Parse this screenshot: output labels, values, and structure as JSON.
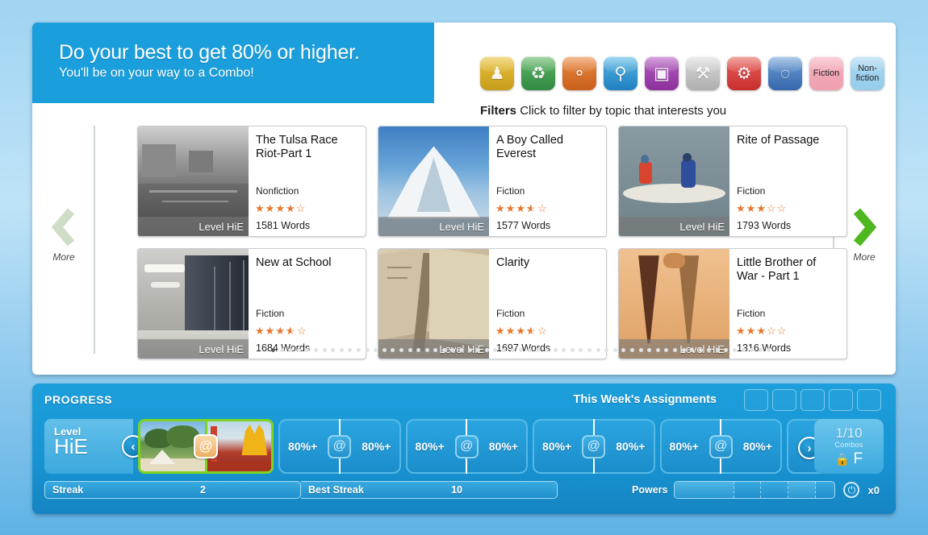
{
  "banner": {
    "line1": "Do your best to get 80% or higher.",
    "line2": "You'll be on your way to a Combo!"
  },
  "filters": {
    "caption_bold": "Filters",
    "caption_rest": "Click to filter by topic that interests you",
    "items": [
      {
        "name": "people-icon",
        "glyph": "♟",
        "color": "#e8c13a",
        "color2": "#c79c1c",
        "label": ""
      },
      {
        "name": "globe-recycle-icon",
        "glyph": "♻",
        "color": "#5fb463",
        "color2": "#2e8b42",
        "label": ""
      },
      {
        "name": "animal-icon",
        "glyph": "⚬",
        "color": "#e8853c",
        "color2": "#c9601c",
        "label": ""
      },
      {
        "name": "magnifier-science-icon",
        "glyph": "⚲",
        "color": "#57b6e4",
        "color2": "#1f7fc0",
        "label": ""
      },
      {
        "name": "camera-arts-icon",
        "glyph": "▣",
        "color": "#b35ec0",
        "color2": "#8d2f9c",
        "label": ""
      },
      {
        "name": "tools-icon",
        "glyph": "⚒",
        "color": "#dcdcdc",
        "color2": "#aeaeae",
        "label": ""
      },
      {
        "name": "gear-tech-icon",
        "glyph": "⚙",
        "color": "#e8605a",
        "color2": "#c72e2e",
        "label": ""
      },
      {
        "name": "basketball-sports-icon",
        "glyph": "◌",
        "color": "#6e9fd6",
        "color2": "#3567ab",
        "label": ""
      },
      {
        "name": "fiction-filter",
        "glyph": "",
        "color": "#f4aebb",
        "color2": "#efa0b0",
        "label": "Fiction"
      },
      {
        "name": "nonfiction-filter",
        "glyph": "",
        "color": "#a7d6ef",
        "color2": "#95cdec",
        "label": "Non-\nfiction"
      }
    ]
  },
  "carousel": {
    "prev_label": "More",
    "next_label": "More",
    "dot_count": 59,
    "active_dot": 0,
    "cards": [
      {
        "title": "The Tulsa Race Riot-Part 1",
        "level": "Level HiE",
        "genre": "Nonfiction",
        "rating": 4,
        "words": "1581 Words",
        "img": "tulsa-ruins-bw"
      },
      {
        "title": "A Boy Called Everest",
        "level": "Level HiE",
        "genre": "Fiction",
        "rating": 3.5,
        "words": "1577 Words",
        "img": "snowy-mountain"
      },
      {
        "title": "Rite of Passage",
        "level": "Level HiE",
        "genre": "Fiction",
        "rating": 3,
        "words": "1793 Words",
        "img": "canoe-on-water"
      },
      {
        "title": "New at School",
        "level": "Level HiE",
        "genre": "Fiction",
        "rating": 3.5,
        "words": "1684 Words",
        "img": "school-hallway-lockers"
      },
      {
        "title": "Clarity",
        "level": "Level HiE",
        "genre": "Fiction",
        "rating": 3.5,
        "words": "1697 Words",
        "img": "open-old-book"
      },
      {
        "title": "Little Brother of War",
        "title2": "- Part 1",
        "level": "Level HiE",
        "genre": "Fiction",
        "rating": 3,
        "words": "1316 Words",
        "img": "lacrosse-sticks"
      }
    ]
  },
  "progress": {
    "title": "PROGRESS",
    "assignments_label": "This Week's Assignments",
    "assignment_box_count": 5,
    "level_label": "Level",
    "level_value": "HiE",
    "prev_glyph": "‹",
    "next_glyph": "›",
    "slots": [
      {
        "left": "80%+",
        "right": "80%+"
      },
      {
        "left": "80%+",
        "right": "80%+"
      },
      {
        "left": "80%+",
        "right": "80%+"
      },
      {
        "left": "80%+",
        "right": "80%+"
      }
    ],
    "combo": {
      "fraction": "1/10",
      "word": "Combos",
      "grade": "F",
      "lock_glyph": "🔒"
    }
  },
  "stats": {
    "streak_label": "Streak",
    "streak_value": "2",
    "best_streak_label": "Best Streak",
    "best_streak_value": "10",
    "powers_label": "Powers",
    "power_count": "x0",
    "power_glyph": "⏻"
  },
  "colors": {
    "brand_blue": "#1b9fdc",
    "star_orange": "#e8762c",
    "arrow_green": "#4fb821",
    "arrow_green_disabled": "#cfddc6"
  }
}
